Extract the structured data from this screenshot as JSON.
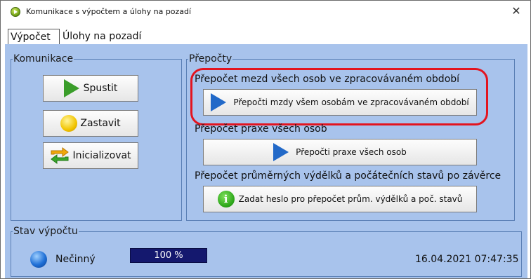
{
  "window": {
    "title": "Komunikace s výpočtem a úlohy na pozadí",
    "close_symbol": "✕"
  },
  "tabs": [
    {
      "label": "Výpočet",
      "active": true
    },
    {
      "label": "Úlohy na pozadí",
      "active": false
    }
  ],
  "komunikace": {
    "legend": "Komunikace",
    "buttons": [
      {
        "label": "Spustit",
        "icon": "play-green-icon"
      },
      {
        "label": "Zastavit",
        "icon": "stop-yellow-icon"
      },
      {
        "label": "Inicializovat",
        "icon": "sync-arrows-icon"
      }
    ]
  },
  "prepocty": {
    "legend": "Přepočty",
    "sections": [
      {
        "label": "Přepočet mezd všech osob ve zpracovávaném období",
        "button_label": "Přepočti mzdy všem osobám ve zpracovávaném období",
        "icon": "play-blue-icon",
        "highlighted": true
      },
      {
        "label": "Přepočet praxe všech osob",
        "button_label": "Přepočti praxe všech osob",
        "icon": "play-blue-icon",
        "highlighted": false
      },
      {
        "label": "Přepočet průměrných výdělků a počátečních stavů po závěrce",
        "button_label": "Zadat heslo pro přepočet prům. výdělků a poč. stavů",
        "icon": "info-green-icon",
        "highlighted": false
      }
    ]
  },
  "stav": {
    "legend": "Stav výpočtu",
    "status_text": "Nečinný",
    "progress_percent": 100,
    "progress_text": "100 %",
    "datetime": "16.04.2021 07:47:35"
  },
  "colors": {
    "client_bg": "#a8c3ec",
    "group_border": "#5a7fb5",
    "highlight": "#e3141f",
    "progress": "#14186e"
  }
}
